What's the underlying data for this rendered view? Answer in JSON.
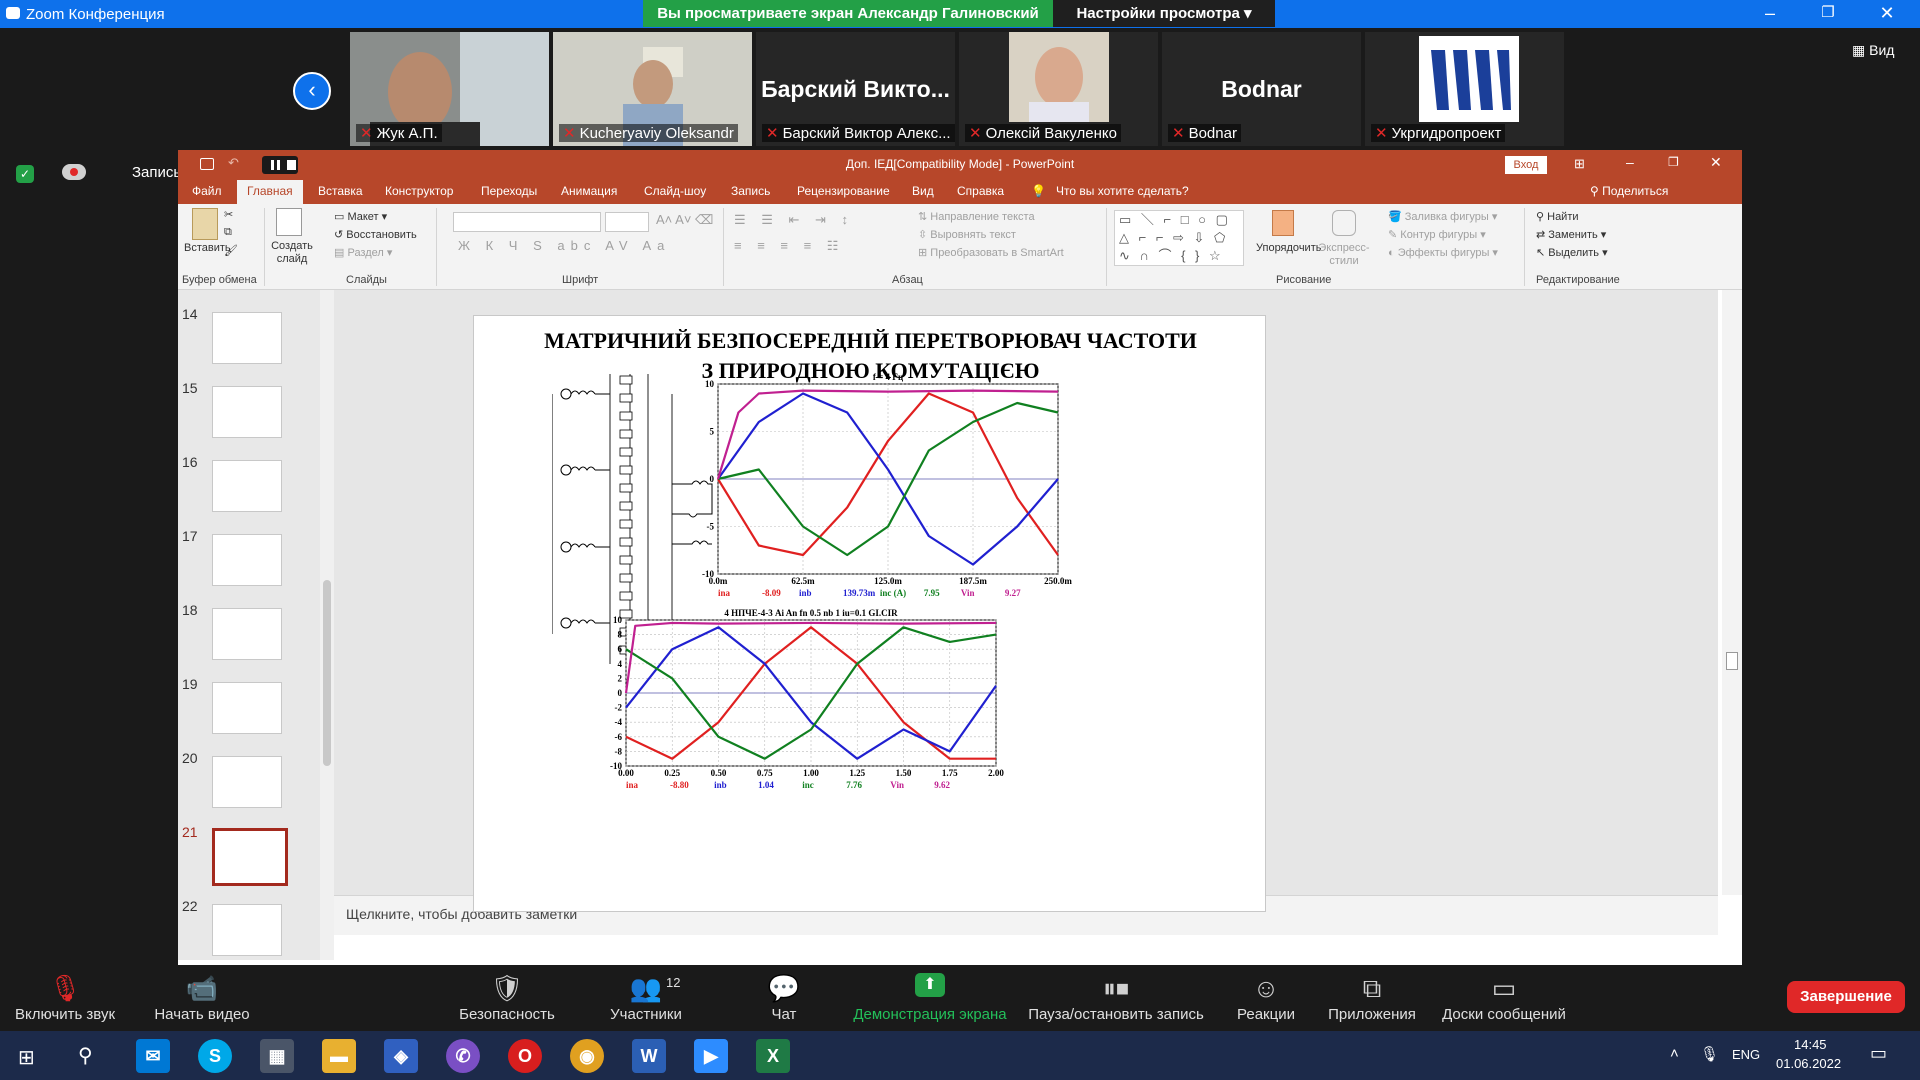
{
  "zoom": {
    "window_title": "Zoom Конференция",
    "banner_viewing": "Вы просматриваете экран Александр Галиновский",
    "banner_settings": "Настройки просмотра",
    "view_button": "Вид",
    "recording_label": "Запись...",
    "participants": [
      {
        "name": "Жук А.П.",
        "big_name": ""
      },
      {
        "name": "Kucheryaviy Oleksandr",
        "big_name": ""
      },
      {
        "name": "Барский Виктор Алекс...",
        "big_name": "Барский Викто..."
      },
      {
        "name": "Олексій Вакуленко",
        "big_name": ""
      },
      {
        "name": "Bodnar",
        "big_name": "Bodnar"
      },
      {
        "name": "Укргидропроект",
        "big_name": ""
      }
    ],
    "toolbar": {
      "mute": "Включить звук",
      "video": "Начать видео",
      "security": "Безопасность",
      "participants": "Участники",
      "participants_count": "12",
      "chat": "Чат",
      "share": "Демонстрация экрана",
      "pause_record": "Пауза/остановить запись",
      "reactions": "Реакции",
      "apps": "Приложения",
      "whiteboards": "Доски сообщений",
      "end": "Завершение"
    }
  },
  "ppt": {
    "doc_title": "Доп. IEД[Compatibility Mode] - PowerPoint",
    "signin": "Вход",
    "share": "Поделиться",
    "tabs": [
      "Файл",
      "Главная",
      "Вставка",
      "Конструктор",
      "Переходы",
      "Анимация",
      "Слайд-шоу",
      "Запись",
      "Рецензирование",
      "Вид",
      "Справка"
    ],
    "tellme": "Что вы хотите сделать?",
    "ribbon": {
      "paste": "Вставить",
      "clipboard": "Буфер обмена",
      "new_slide": "Создать слайд",
      "layout": "Макет",
      "reset": "Восстановить",
      "section": "Раздел",
      "slides": "Слайды",
      "font": "Шрифт",
      "text_direction": "Направление текста",
      "align_text": "Выровнять текст",
      "smartart": "Преобразовать в SmartArt",
      "paragraph": "Абзац",
      "arrange": "Упорядочить",
      "quick_styles": "Экспресс-стили",
      "shape_fill": "Заливка фигуры",
      "shape_outline": "Контур фигуры",
      "shape_effects": "Эффекты фигуры",
      "drawing": "Рисование",
      "find": "Найти",
      "replace": "Заменить",
      "select": "Выделить",
      "editing": "Редактирование"
    },
    "thumbnails": [
      "14",
      "15",
      "16",
      "17",
      "18",
      "19",
      "20",
      "21",
      "22"
    ],
    "selected_slide": "21",
    "notes_placeholder": "Щелкните, чтобы добавить заметки",
    "slide": {
      "title_line1": "МАТРИЧНИЙ БЕЗПОСЕРЕДНІЙ ПЕРЕТВОРЮВАЧ ЧАСТОТИ",
      "title_line2": "З ПРИРОДНОЮ КОМУТАЦІЄЮ"
    }
  },
  "chart_data": [
    {
      "type": "line",
      "title": "f = 4 Гц",
      "x_ticks": [
        "0.0m",
        "62.5m",
        "125.0m",
        "187.5m",
        "250.0m"
      ],
      "y_ticks": [
        "-10",
        "-5",
        "0",
        "5",
        "10"
      ],
      "ylim": [
        -10,
        10
      ],
      "xlim": [
        0,
        250
      ],
      "legend": [
        {
          "name": "ina",
          "value": "-8.09",
          "color": "#e02020"
        },
        {
          "name": "inb",
          "value": "139.73m",
          "color": "#2020d0"
        },
        {
          "name": "inc (A)",
          "value": "7.95",
          "color": "#108020"
        },
        {
          "name": "Vin",
          "value": "9.27",
          "color": "#c02090"
        }
      ],
      "series": [
        {
          "name": "ina",
          "color": "#e02020",
          "x": [
            0,
            30,
            62.5,
            95,
            125,
            155,
            187.5,
            220,
            250
          ],
          "y": [
            0,
            -7,
            -8,
            -3,
            4,
            9,
            7,
            -2,
            -8
          ]
        },
        {
          "name": "inb",
          "color": "#2020d0",
          "x": [
            0,
            30,
            62.5,
            95,
            125,
            155,
            187.5,
            220,
            250
          ],
          "y": [
            0,
            6,
            9,
            7,
            1,
            -6,
            -9,
            -5,
            0
          ]
        },
        {
          "name": "inc",
          "color": "#108020",
          "x": [
            0,
            30,
            62.5,
            95,
            125,
            155,
            187.5,
            220,
            250
          ],
          "y": [
            0,
            1,
            -5,
            -8,
            -5,
            3,
            6,
            8,
            7
          ]
        },
        {
          "name": "Vin",
          "color": "#c02090",
          "x": [
            0,
            15,
            30,
            62.5,
            125,
            187.5,
            250
          ],
          "y": [
            0,
            7,
            9,
            9.3,
            9.2,
            9.3,
            9.2
          ]
        }
      ]
    },
    {
      "type": "line",
      "title": "4 НПЧЕ-4-3 Ai An fn 0.5 nb 1 iu=0.1 GI.CIR",
      "x_ticks": [
        "0.00",
        "0.25",
        "0.50",
        "0.75",
        "1.00",
        "1.25",
        "1.50",
        "1.75",
        "2.00"
      ],
      "y_ticks": [
        "10",
        "8",
        "6",
        "4",
        "2",
        "0",
        "-2",
        "-4",
        "-6",
        "-8",
        "-10"
      ],
      "ylim": [
        -10,
        10
      ],
      "xlim": [
        0,
        2
      ],
      "legend": [
        {
          "name": "ina",
          "value": "-8.80",
          "color": "#e02020"
        },
        {
          "name": "inb",
          "value": "1.04",
          "color": "#2020d0"
        },
        {
          "name": "inc",
          "value": "7.76",
          "color": "#108020"
        },
        {
          "name": "Vin",
          "value": "9.62",
          "color": "#c02090"
        }
      ],
      "series": [
        {
          "name": "ina",
          "color": "#e02020",
          "x": [
            0,
            0.25,
            0.5,
            0.75,
            1.0,
            1.25,
            1.5,
            1.75,
            2.0
          ],
          "y": [
            -6,
            -9,
            -4,
            4,
            9,
            4,
            -4,
            -9,
            -9
          ]
        },
        {
          "name": "inb",
          "color": "#2020d0",
          "x": [
            0,
            0.25,
            0.5,
            0.75,
            1.0,
            1.25,
            1.5,
            1.75,
            2.0
          ],
          "y": [
            -2,
            6,
            9,
            4,
            -4,
            -9,
            -5,
            -8,
            1
          ]
        },
        {
          "name": "inc",
          "color": "#108020",
          "x": [
            0,
            0.25,
            0.5,
            0.75,
            1.0,
            1.25,
            1.5,
            1.75,
            2.0
          ],
          "y": [
            6,
            2,
            -6,
            -9,
            -5,
            4,
            9,
            7,
            8
          ]
        },
        {
          "name": "Vin",
          "color": "#c02090",
          "x": [
            0,
            0.05,
            0.25,
            0.5,
            1.0,
            1.5,
            2.0
          ],
          "y": [
            0,
            9.2,
            9.6,
            9.5,
            9.6,
            9.5,
            9.6
          ]
        }
      ]
    }
  ],
  "taskbar": {
    "lang": "ENG",
    "time": "14:45",
    "date": "01.06.2022"
  }
}
